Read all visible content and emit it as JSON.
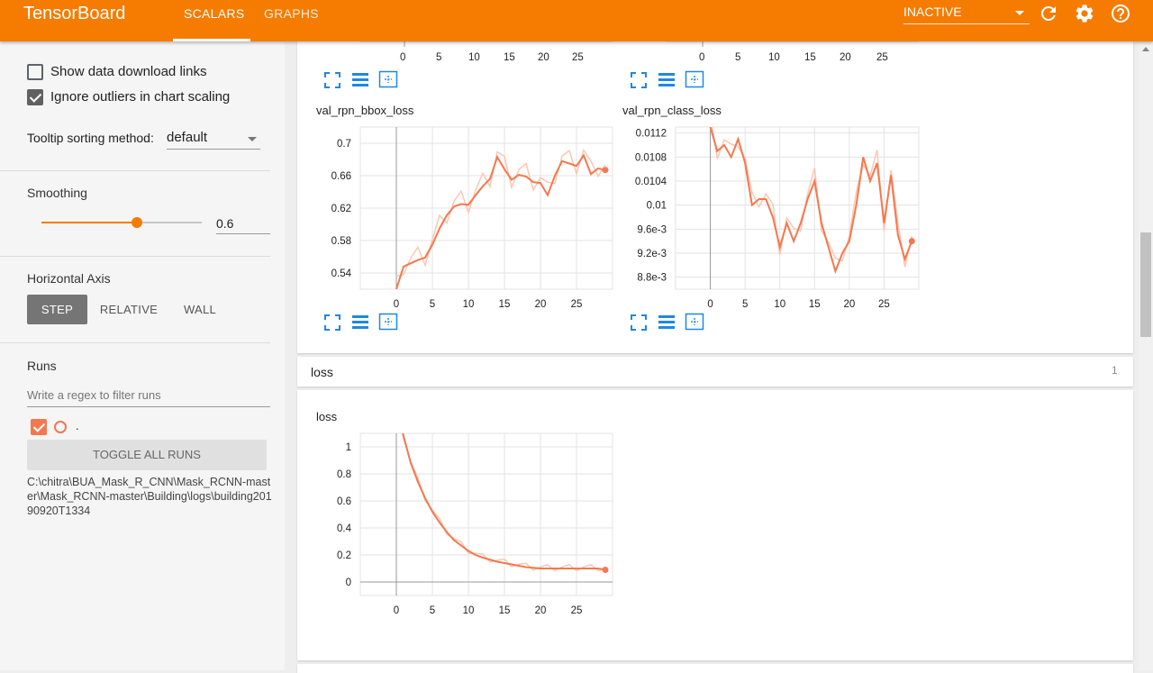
{
  "app": {
    "title": "TensorBoard",
    "tabs": [
      {
        "label": "SCALARS",
        "active": true
      },
      {
        "label": "GRAPHS",
        "active": false
      }
    ],
    "status_select": "INACTIVE",
    "accent_color": "#f57c00"
  },
  "sidebar": {
    "show_download_label": "Show data download links",
    "show_download_checked": false,
    "ignore_outliers_label": "Ignore outliers in chart scaling",
    "ignore_outliers_checked": true,
    "tooltip_label": "Tooltip sorting method:",
    "tooltip_value": "default",
    "smoothing_title": "Smoothing",
    "smoothing_value": "0.6",
    "smoothing_fraction": 0.6,
    "horizontal_axis_title": "Horizontal Axis",
    "axis_options": [
      "STEP",
      "RELATIVE",
      "WALL"
    ],
    "axis_selected": "STEP",
    "runs_title": "Runs",
    "runs_filter_placeholder": "Write a regex to filter runs",
    "run_label": ".",
    "run_color": "#f4784e",
    "toggle_all_label": "TOGGLE ALL RUNS",
    "run_path": "C:\\chitra\\BUA_Mask_R_CNN\\Mask_RCNN-master\\Mask_RCNN-master\\Building\\logs\\building20190920T1334"
  },
  "main": {
    "top_partial_x_ticks": [
      "0",
      "5",
      "10",
      "15",
      "20",
      "25"
    ],
    "charts": [
      {
        "title": "val_rpn_bbox_loss",
        "y_ticks": [
          "0.7",
          "0.66",
          "0.62",
          "0.58",
          "0.54"
        ],
        "x_ticks": [
          "0",
          "5",
          "10",
          "15",
          "20",
          "25"
        ]
      },
      {
        "title": "val_rpn_class_loss",
        "y_ticks": [
          "0.0112",
          "0.0108",
          "0.0104",
          "0.01",
          "9.6e-3",
          "9.2e-3",
          "8.8e-3"
        ],
        "x_ticks": [
          "0",
          "5",
          "10",
          "15",
          "20",
          "25"
        ]
      }
    ],
    "loss_group": {
      "label": "loss",
      "count": "1"
    },
    "loss_chart": {
      "title": "loss",
      "y_ticks": [
        "1",
        "0.8",
        "0.6",
        "0.4",
        "0.2",
        "0"
      ],
      "x_ticks": [
        "0",
        "5",
        "10",
        "15",
        "20",
        "25"
      ]
    }
  },
  "chart_data": [
    {
      "type": "line",
      "title": "val_rpn_bbox_loss",
      "xlabel": "",
      "ylabel": "",
      "xlim": [
        -5,
        30
      ],
      "ylim": [
        0.52,
        0.72
      ],
      "series": [
        {
          "x": [
            0,
            1,
            2,
            3,
            4,
            5,
            6,
            7,
            8,
            9,
            10,
            11,
            12,
            13,
            14,
            15,
            16,
            17,
            18,
            19,
            20,
            21,
            22,
            23,
            24,
            25,
            26,
            27,
            28,
            29
          ],
          "values": [
            0.52,
            0.548,
            0.552,
            0.556,
            0.559,
            0.575,
            0.595,
            0.611,
            0.622,
            0.625,
            0.624,
            0.636,
            0.647,
            0.656,
            0.683,
            0.668,
            0.655,
            0.661,
            0.659,
            0.652,
            0.651,
            0.636,
            0.66,
            0.678,
            0.675,
            0.672,
            0.685,
            0.662,
            0.669,
            0.667
          ]
        }
      ]
    },
    {
      "type": "line",
      "title": "val_rpn_class_loss",
      "xlabel": "",
      "ylabel": "",
      "xlim": [
        -5,
        30
      ],
      "ylim": [
        0.0086,
        0.0113
      ],
      "series": [
        {
          "x": [
            0,
            1,
            2,
            3,
            4,
            5,
            6,
            7,
            8,
            9,
            10,
            11,
            12,
            13,
            14,
            15,
            16,
            17,
            18,
            19,
            20,
            21,
            22,
            23,
            24,
            25,
            26,
            27,
            28,
            29
          ],
          "values": [
            0.0113,
            0.0109,
            0.011,
            0.0108,
            0.0111,
            0.0107,
            0.01,
            0.0101,
            0.0101,
            0.0098,
            0.0093,
            0.0097,
            0.0094,
            0.0097,
            0.0101,
            0.0104,
            0.0097,
            0.0093,
            0.0089,
            0.0092,
            0.0094,
            0.01,
            0.0108,
            0.0104,
            0.0107,
            0.0097,
            0.0105,
            0.0095,
            0.0091,
            0.0094
          ]
        }
      ]
    },
    {
      "type": "line",
      "title": "loss",
      "xlabel": "",
      "ylabel": "",
      "xlim": [
        -5,
        30
      ],
      "ylim": [
        -0.1,
        1.1
      ],
      "series": [
        {
          "x": [
            0,
            1,
            2,
            3,
            4,
            5,
            6,
            7,
            8,
            9,
            10,
            11,
            12,
            13,
            14,
            15,
            16,
            17,
            18,
            19,
            20,
            21,
            22,
            23,
            24,
            25,
            26,
            27,
            28,
            29
          ],
          "values": [
            1.3,
            1.08,
            0.88,
            0.74,
            0.62,
            0.52,
            0.44,
            0.37,
            0.31,
            0.27,
            0.23,
            0.2,
            0.18,
            0.165,
            0.15,
            0.14,
            0.13,
            0.12,
            0.11,
            0.105,
            0.1,
            0.1,
            0.1,
            0.1,
            0.1,
            0.1,
            0.1,
            0.1,
            0.1,
            0.09
          ]
        }
      ]
    }
  ]
}
